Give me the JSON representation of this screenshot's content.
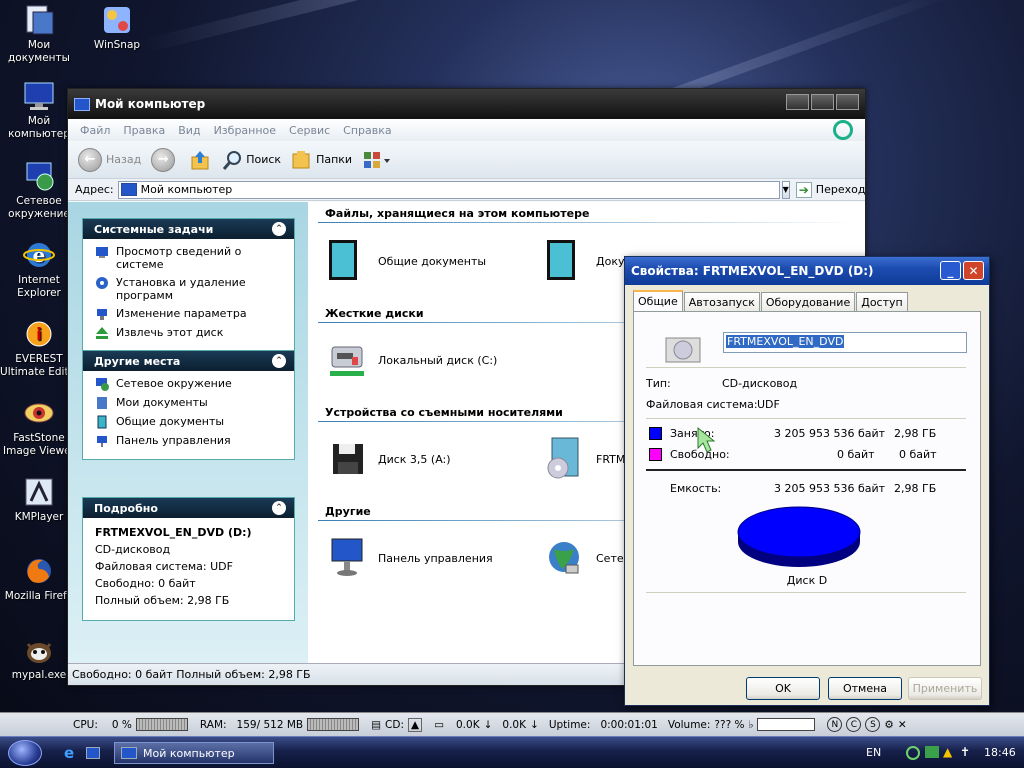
{
  "desktop": {
    "icons": [
      {
        "label": "Мои\nдокументы",
        "icon": "my-documents-icon"
      },
      {
        "label": "WinSnap",
        "icon": "winsnap-icon"
      },
      {
        "label": "Мой\nкомпьютер",
        "icon": "my-computer-icon"
      },
      {
        "label": "Сетевое\nокружение",
        "icon": "network-icon"
      },
      {
        "label": "Internet\nExplorer",
        "icon": "ie-icon"
      },
      {
        "label": "EVEREST\nUltimate Editio",
        "icon": "everest-icon"
      },
      {
        "label": "FastStone\nImage Viewer",
        "icon": "faststone-icon"
      },
      {
        "label": "KMPlayer",
        "icon": "kmplayer-icon"
      },
      {
        "label": "Mozilla Firefo",
        "icon": "firefox-icon"
      },
      {
        "label": "mypal.exe",
        "icon": "mypal-icon"
      }
    ]
  },
  "explorer": {
    "title": "Мой компьютер",
    "menu": [
      "Файл",
      "Правка",
      "Вид",
      "Избранное",
      "Сервис",
      "Справка"
    ],
    "toolbar": {
      "back": "Назад",
      "search": "Поиск",
      "folders": "Папки"
    },
    "address": {
      "label": "Адрес:",
      "value": "Мой компьютер",
      "go": "Переход"
    },
    "system_tasks": {
      "title": "Системные задачи",
      "items": [
        "Просмотр сведений о системе",
        "Установка и удаление программ",
        "Изменение параметра",
        "Извлечь этот диск"
      ]
    },
    "other_places": {
      "title": "Другие места",
      "items": [
        "Сетевое окружение",
        "Мои документы",
        "Общие документы",
        "Панель управления"
      ]
    },
    "details": {
      "title": "Подробно",
      "name": "FRTMEXVOL_EN_DVD (D:)",
      "type": "CD-дисковод",
      "fs": "Файловая система: UDF",
      "free": "Свободно: 0 байт",
      "total": "Полный объем: 2,98 ГБ"
    },
    "groups": {
      "files": "Файлы, хранящиеся на этом компьютере",
      "hdd": "Жесткие диски",
      "removable": "Устройства со съемными носителями",
      "other": "Другие"
    },
    "items": {
      "shared_docs": "Общие документы",
      "docs2": "Доку",
      "local_c": "Локальный диск (C:)",
      "floppy": "Диск 3,5 (A:)",
      "dvd": "FRTM",
      "control_panel": "Панель управления",
      "network": "Сете"
    },
    "status": "Свободно: 0 байт Полный объем: 2,98 ГБ"
  },
  "dialog": {
    "title": "Свойства: FRTMEXVOL_EN_DVD (D:)",
    "tabs": [
      "Общие",
      "Автозапуск",
      "Оборудование",
      "Доступ"
    ],
    "volume_name": "FRTMEXVOL_EN_DVD",
    "type_label": "Тип:",
    "type_value": "CD-дисковод",
    "fs_label": "Файловая система:",
    "fs_value": "UDF",
    "used_label": "Занято:",
    "used_bytes": "3 205 953 536 байт",
    "used_gb": "2,98 ГБ",
    "free_label": "Свободно:",
    "free_bytes": "0 байт",
    "free_gb": "0 байт",
    "capacity_label": "Емкость:",
    "capacity_bytes": "3 205 953 536 байт",
    "capacity_gb": "2,98 ГБ",
    "disk_label": "Диск D",
    "ok": "OK",
    "cancel": "Отмена",
    "apply": "Применить",
    "used_color": "#0000ff",
    "free_color": "#ff00ff"
  },
  "sysbar": {
    "cpu_label": "CPU:",
    "cpu_value": "0 %",
    "ram_label": "RAM:",
    "ram_value": "159/ 512 MB",
    "cd_label": "CD:",
    "net_down": "0.0K",
    "net_up": "0.0K",
    "uptime_label": "Uptime:",
    "uptime_value": "0:00:01:01",
    "volume_label": "Volume:",
    "volume_value": "??? %"
  },
  "taskbar": {
    "task": "Мой компьютер",
    "lang": "EN",
    "clock": "18:46"
  }
}
